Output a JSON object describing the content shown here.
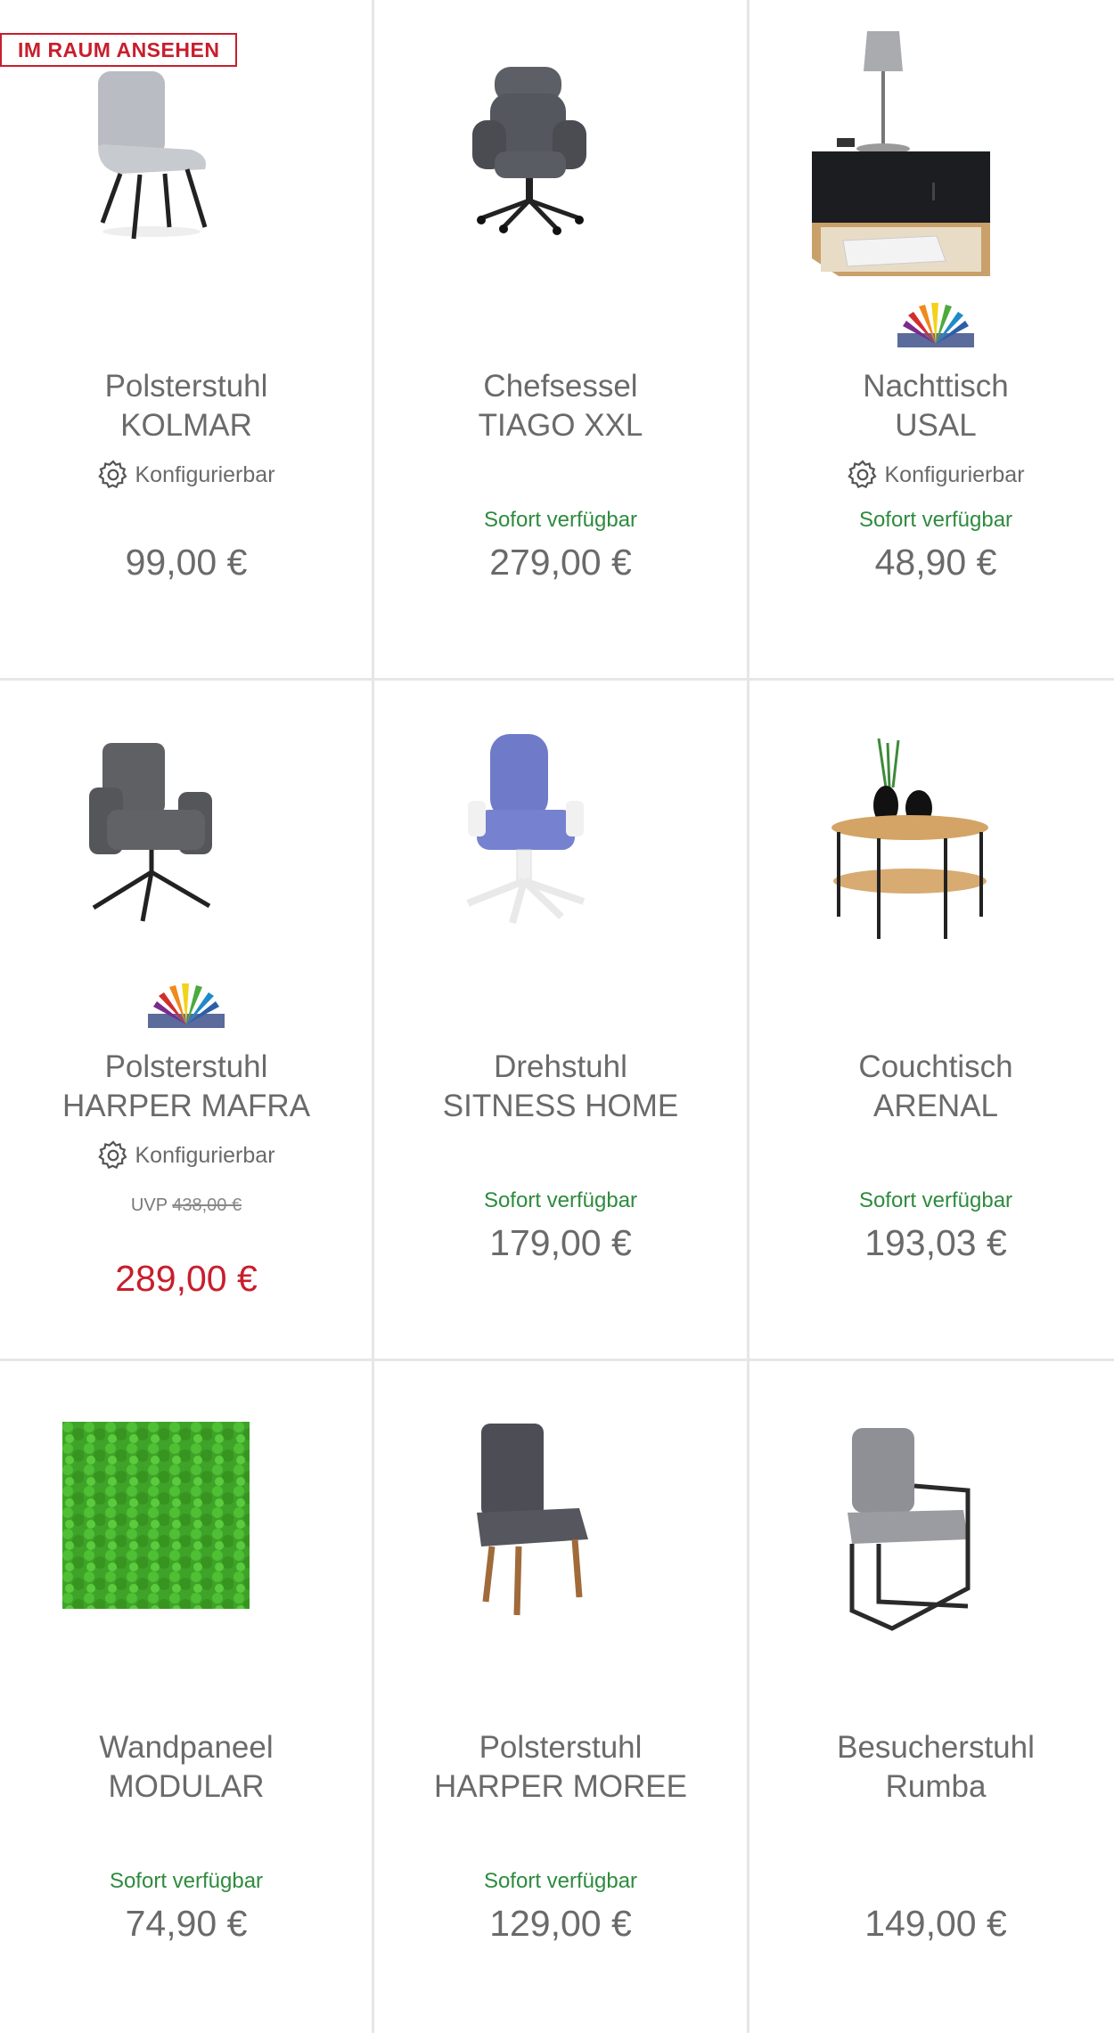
{
  "badge": {
    "label": "IM RAUM ANSEHEN"
  },
  "config_label": "Konfigurierbar",
  "colors": {
    "available": "#2e8b3e",
    "sale": "#c81e2c",
    "text": "#6a6a6a"
  },
  "products": [
    {
      "name1": "Polsterstuhl",
      "name2": "KOLMAR",
      "configurable": "Konfigurierbar",
      "availability": "",
      "uvp_label": "",
      "uvp_price": "",
      "price": "99,00 €",
      "icon": "grey-dining-chair-image"
    },
    {
      "name1": "Chefsessel",
      "name2": "TIAGO XXL",
      "configurable": "",
      "availability": "Sofort verfügbar",
      "uvp_label": "",
      "uvp_price": "",
      "price": "279,00 €",
      "icon": "executive-office-chair-image"
    },
    {
      "name1": "Nachttisch",
      "name2": "USAL",
      "configurable": "Konfigurierbar",
      "availability": "Sofort verfügbar",
      "uvp_label": "",
      "uvp_price": "",
      "price": "48,90 €",
      "icon": "nightstand-image"
    },
    {
      "name1": "Polsterstuhl",
      "name2": "HARPER MAFRA",
      "configurable": "Konfigurierbar",
      "availability": "",
      "uvp_label": "UVP",
      "uvp_price": "438,00 €",
      "price": "289,00 €",
      "icon": "armchair-image"
    },
    {
      "name1": "Drehstuhl",
      "name2": "SITNESS HOME",
      "configurable": "",
      "availability": "Sofort verfügbar",
      "uvp_label": "",
      "uvp_price": "",
      "price": "179,00 €",
      "icon": "swivel-chair-image"
    },
    {
      "name1": "Couchtisch",
      "name2": "ARENAL",
      "configurable": "",
      "availability": "Sofort verfügbar",
      "uvp_label": "",
      "uvp_price": "",
      "price": "193,03 €",
      "icon": "coffee-table-image"
    },
    {
      "name1": "Wandpaneel",
      "name2": "MODULAR",
      "configurable": "",
      "availability": "Sofort verfügbar",
      "uvp_label": "",
      "uvp_price": "",
      "price": "74,90 €",
      "icon": "moss-wall-panel-image"
    },
    {
      "name1": "Polsterstuhl",
      "name2": "HARPER MOREE",
      "configurable": "",
      "availability": "Sofort verfügbar",
      "uvp_label": "",
      "uvp_price": "",
      "price": "129,00 €",
      "icon": "upholstered-chair-image"
    },
    {
      "name1": "Besucherstuhl",
      "name2": "Rumba",
      "configurable": "",
      "availability": "",
      "uvp_label": "",
      "uvp_price": "",
      "price": "149,00 €",
      "icon": "visitor-chair-image"
    }
  ]
}
